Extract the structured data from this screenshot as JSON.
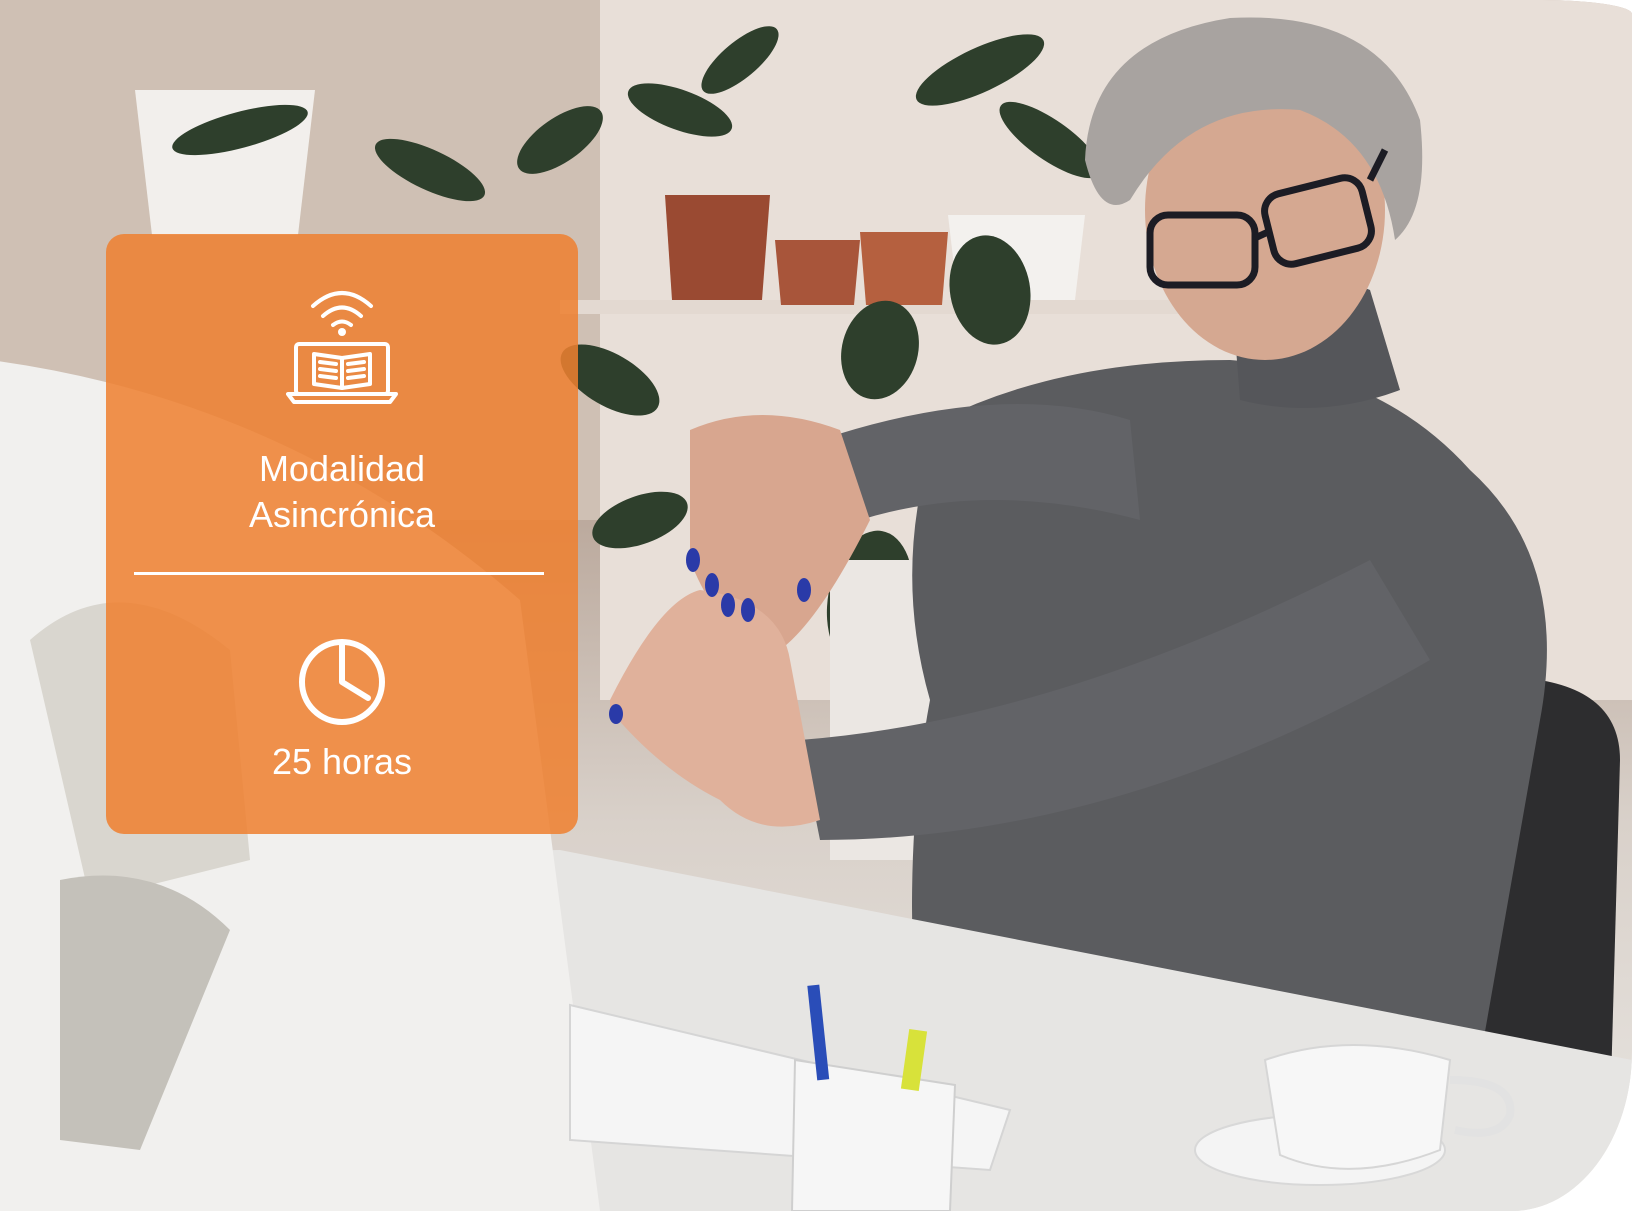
{
  "card": {
    "icons": {
      "modality": "wifi-laptop-book-icon",
      "duration": "clock-icon"
    },
    "modality_line1": "Modalidad",
    "modality_line2": "Asincrónica",
    "duration": "25 horas"
  },
  "colors": {
    "card_orange": "#EF8030",
    "text": "#FFFFFF"
  }
}
